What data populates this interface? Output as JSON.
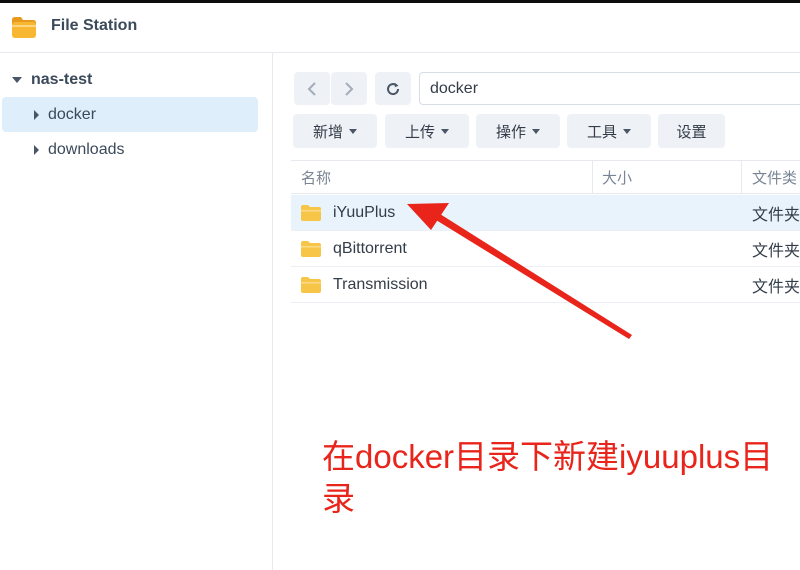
{
  "app": {
    "title": "File Station"
  },
  "sidebar": {
    "root": "nas-test",
    "items": [
      {
        "label": "docker",
        "selected": true
      },
      {
        "label": "downloads",
        "selected": false
      }
    ]
  },
  "toolbar": {
    "path": "docker",
    "buttons": [
      {
        "label": "新增",
        "dropdown": true
      },
      {
        "label": "上传",
        "dropdown": true
      },
      {
        "label": "操作",
        "dropdown": true
      },
      {
        "label": "工具",
        "dropdown": true
      },
      {
        "label": "设置",
        "dropdown": false
      }
    ]
  },
  "table": {
    "columns": [
      "名称",
      "大小",
      "文件类"
    ],
    "rows": [
      {
        "name": "iYuuPlus",
        "size": "",
        "type": "文件夹"
      },
      {
        "name": "qBittorrent",
        "size": "",
        "type": "文件夹"
      },
      {
        "name": "Transmission",
        "size": "",
        "type": "文件夹"
      }
    ]
  },
  "annotation": {
    "text": "在docker目录下新建iyuuplus目录",
    "color": "#e8241b"
  },
  "colors": {
    "folder": "#f7c548",
    "selected_bg": "#dfeefb",
    "arrow": "#e8241b"
  }
}
